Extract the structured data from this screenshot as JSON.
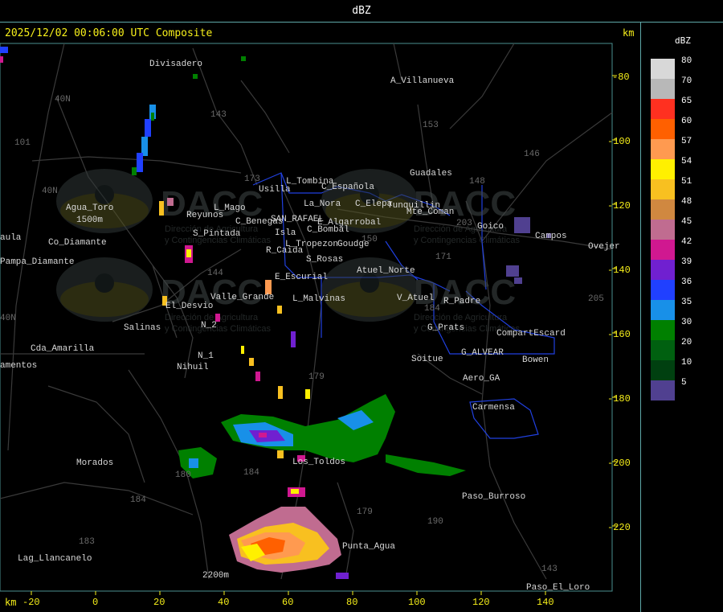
{
  "window": {
    "title": "dBZ"
  },
  "header": {
    "timestamp": "2025/12/02 00:06:00 UTC Composite",
    "unit_top": "km",
    "unit_bottom": "km"
  },
  "legend": {
    "title": "dBZ",
    "levels": [
      {
        "label": "80",
        "color": "#d8d8d8"
      },
      {
        "label": "70",
        "color": "#b8b8b8"
      },
      {
        "label": "65",
        "color": "#ff3020"
      },
      {
        "label": "60",
        "color": "#ff6000"
      },
      {
        "label": "57",
        "color": "#ff9a50"
      },
      {
        "label": "54",
        "color": "#fff000"
      },
      {
        "label": "51",
        "color": "#f8c020"
      },
      {
        "label": "48",
        "color": "#d08840"
      },
      {
        "label": "45",
        "color": "#c06c90"
      },
      {
        "label": "42",
        "color": "#d01890"
      },
      {
        "label": "39",
        "color": "#7020d0"
      },
      {
        "label": "36",
        "color": "#2040ff"
      },
      {
        "label": "35",
        "color": "#1890e8"
      },
      {
        "label": "30",
        "color": "#008000"
      },
      {
        "label": "20",
        "color": "#006010"
      },
      {
        "label": "10",
        "color": "#004010"
      },
      {
        "label": "5",
        "color": "#504090"
      }
    ]
  },
  "axes": {
    "x_ticks": [
      "-20",
      "0",
      "20",
      "40",
      "60",
      "80",
      "100",
      "120",
      "140"
    ],
    "y_ticks": [
      "-80",
      "-100",
      "-120",
      "-140",
      "-160",
      "-180",
      "-200",
      "-220"
    ]
  },
  "places": [
    {
      "name": "Divisadero"
    },
    {
      "name": "A_Villanueva"
    },
    {
      "name": "L_Tombina"
    },
    {
      "name": "Usilla"
    },
    {
      "name": "C_Española"
    },
    {
      "name": "Guadales"
    },
    {
      "name": "Agua_Toro"
    },
    {
      "name": "1500m"
    },
    {
      "name": "Reyunos"
    },
    {
      "name": "L_Mago"
    },
    {
      "name": "La_Nora"
    },
    {
      "name": "C_Elepa"
    },
    {
      "name": "Tunquillin"
    },
    {
      "name": "C_Benegas"
    },
    {
      "name": "SAN_RAFAEL"
    },
    {
      "name": "E_Algarrobal"
    },
    {
      "name": "Goico"
    },
    {
      "name": "Campos"
    },
    {
      "name": "Ovejer"
    },
    {
      "name": "Pampa_Diamante"
    },
    {
      "name": "S_Pintada"
    },
    {
      "name": "Isla"
    },
    {
      "name": "C_Bombal"
    },
    {
      "name": "L_Tropezon"
    },
    {
      "name": "Goudge"
    },
    {
      "name": "Mte_Coman"
    },
    {
      "name": "R_Caida"
    },
    {
      "name": "S_Rosas"
    },
    {
      "name": "Atuel_Norte"
    },
    {
      "name": "E_Escurial"
    },
    {
      "name": "Valle_Grande"
    },
    {
      "name": "L_Malvinas"
    },
    {
      "name": "V_Atuel"
    },
    {
      "name": "R_Padre"
    },
    {
      "name": "El_Desvio"
    },
    {
      "name": "N_2"
    },
    {
      "name": "Salinas"
    },
    {
      "name": "G_Prats"
    },
    {
      "name": "CompartEscard"
    },
    {
      "name": "Cda_Amarilla"
    },
    {
      "name": "N_1"
    },
    {
      "name": "G_ALVEAR"
    },
    {
      "name": "Bowen"
    },
    {
      "name": "Soitue"
    },
    {
      "name": "Aero_GA"
    },
    {
      "name": "Nihuil"
    },
    {
      "name": "amentos"
    },
    {
      "name": "Carmensa"
    },
    {
      "name": "Morados"
    },
    {
      "name": "Los_Toldos"
    },
    {
      "name": "Paso_Burroso"
    },
    {
      "name": "Punta_Agua"
    },
    {
      "name": "Lag_Llancanelo"
    },
    {
      "name": "2200m"
    },
    {
      "name": "Paso_El_Loro"
    },
    {
      "name": "aula"
    },
    {
      "name": "Co_Diamante"
    }
  ],
  "route_numbers": [
    "143",
    "153",
    "146",
    "148",
    "203",
    "40N",
    "101",
    "40N",
    "173",
    "171",
    "184",
    "144",
    "179",
    "180",
    "184",
    "184",
    "179",
    "190",
    "143",
    "183",
    "40N",
    "205",
    "150"
  ],
  "watermark": {
    "brand": "DACC",
    "line1": "Dirección de Agricultura",
    "line2": "y Contingencias Climáticas"
  }
}
